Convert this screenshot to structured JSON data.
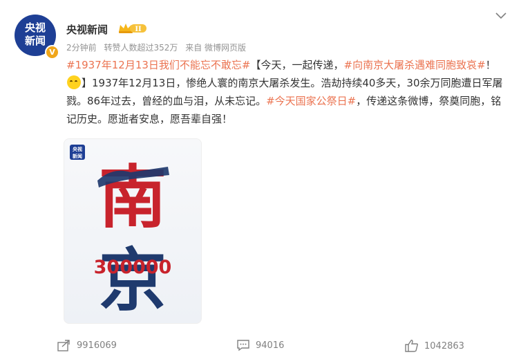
{
  "account": {
    "name": "央视新闻",
    "avatar_text": [
      "央视",
      "新闻"
    ],
    "verified_badge": "V"
  },
  "meta": {
    "time": "2分钟前",
    "reposts_info": "转赞人数超过352万",
    "source": "来自 微博网页版"
  },
  "post": {
    "tag1": "#1937年12月13日我们不能忘不敢忘#",
    "text1": "【今天，一起传递，",
    "tag2": "#向南京大屠杀遇难同胞致哀#",
    "text2": "！",
    "text3": "】1937年12月13日，惨绝人寰的南京大屠杀发生。浩劫持续40多天，30余万同胞遭日军屠戮。86年过去，曾经的血与泪，从未忘记。",
    "tag3": "#今天国家公祭日#",
    "text4": "，传递这条微博，祭奠同胞，铭记历史。愿逝者安息，愿吾辈自强！"
  },
  "poster": {
    "logo_text": [
      "央视",
      "新闻"
    ],
    "char_top": "南",
    "char_bottom": "京",
    "number": "300000"
  },
  "actions": {
    "share_count": "9916069",
    "comment_count": "94016",
    "like_count": "1042863"
  },
  "colors": {
    "tag": "#eb7350",
    "brand_blue": "#1e3f95",
    "poster_red": "#c8232c",
    "poster_navy": "#1f3a6e"
  }
}
